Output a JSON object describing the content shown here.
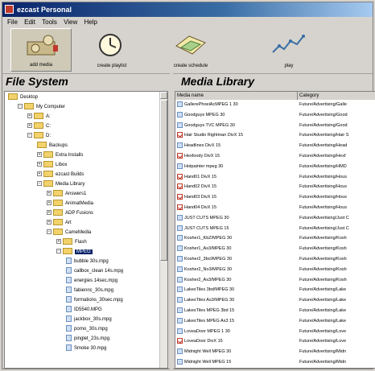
{
  "window": {
    "title": "ezcast Personal"
  },
  "menu": [
    "File",
    "Edit",
    "Tools",
    "View",
    "Help"
  ],
  "toolbar": [
    {
      "label": "add media",
      "icon": "projector-icon"
    },
    {
      "label": "create playlist",
      "icon": "clock-icon"
    },
    {
      "label": "create schedule",
      "icon": "schedule-icon"
    },
    {
      "label": "play",
      "icon": "play-icon"
    }
  ],
  "file_system": {
    "header": "File System",
    "tree": [
      {
        "label": "Desktop",
        "depth": 0,
        "type": "folder"
      },
      {
        "label": "My Computer",
        "depth": 1,
        "type": "folder",
        "expander": "−"
      },
      {
        "label": "A:",
        "depth": 2,
        "type": "drive",
        "expander": "+"
      },
      {
        "label": "C:",
        "depth": 2,
        "type": "drive",
        "expander": "+"
      },
      {
        "label": "D:",
        "depth": 2,
        "type": "drive",
        "expander": "−"
      },
      {
        "label": "Backups",
        "depth": 3,
        "type": "folder"
      },
      {
        "label": "Extra Installs",
        "depth": 3,
        "type": "folder",
        "expander": "+"
      },
      {
        "label": "Libox",
        "depth": 3,
        "type": "folder",
        "expander": "+"
      },
      {
        "label": "ezcast Builds",
        "depth": 3,
        "type": "folder",
        "expander": "+"
      },
      {
        "label": "Media Library",
        "depth": 3,
        "type": "folder",
        "expander": "−"
      },
      {
        "label": "Answers1",
        "depth": 4,
        "type": "folder",
        "expander": "+"
      },
      {
        "label": "AnimatMedia",
        "depth": 4,
        "type": "folder",
        "expander": "+"
      },
      {
        "label": "ADP Fusions",
        "depth": 4,
        "type": "folder",
        "expander": "+"
      },
      {
        "label": "Art",
        "depth": 4,
        "type": "folder",
        "expander": "+"
      },
      {
        "label": "CameMedia",
        "depth": 4,
        "type": "folder",
        "expander": "−"
      },
      {
        "label": "Flash",
        "depth": 5,
        "type": "folder",
        "expander": "+"
      },
      {
        "label": "MPEG",
        "depth": 5,
        "type": "folder",
        "expander": "−",
        "selected": true
      },
      {
        "label": "bubble 30s.mpg",
        "depth": 6,
        "type": "file"
      },
      {
        "label": "callbox_clean 14s.mpg",
        "depth": 6,
        "type": "file"
      },
      {
        "label": "energies 14sec.mpg",
        "depth": 6,
        "type": "file"
      },
      {
        "label": "fabiennc_30s.mpg",
        "depth": 6,
        "type": "file"
      },
      {
        "label": "formations_30sec.mpg",
        "depth": 6,
        "type": "file"
      },
      {
        "label": "ID5540.MPG",
        "depth": 6,
        "type": "file"
      },
      {
        "label": "jackbox_30s.mpg",
        "depth": 6,
        "type": "file"
      },
      {
        "label": "porno_30s.mpg",
        "depth": 6,
        "type": "file"
      },
      {
        "label": "pinglet_23s.mpg",
        "depth": 6,
        "type": "file"
      },
      {
        "label": "Smoke 30.mpg",
        "depth": 6,
        "type": "file"
      }
    ]
  },
  "media_library": {
    "header": "Media Library",
    "columns": [
      "Media name",
      "Category"
    ],
    "rows": [
      {
        "name": "GallerePhoeiAcMPEG 1 30",
        "category": "Future/Advertising/Galle",
        "icon": "video"
      },
      {
        "name": "Goodguys MPEG 30",
        "category": "Future/Advertising/Good",
        "icon": "video"
      },
      {
        "name": "Goodguys TVC MPEG 30",
        "category": "Future/Advertising/Good",
        "icon": "video"
      },
      {
        "name": "Hair Studio Rightman DivX 15",
        "category": "Future/Advertising/Hair S",
        "icon": "check"
      },
      {
        "name": "Headlines DivX 15",
        "category": "Future/Advertising/Head",
        "icon": "video"
      },
      {
        "name": "Hexfoody DivX 15",
        "category": "Future/Advertising/Hexf",
        "icon": "check"
      },
      {
        "name": "Hotpainter mpeg 30",
        "category": "Future/Advertising/HMD",
        "icon": "video"
      },
      {
        "name": "Hand01 DivX 15",
        "category": "Future/Advertising/Hous",
        "icon": "check"
      },
      {
        "name": "Hand02 DivX 15",
        "category": "Future/Advertising/Hous",
        "icon": "check"
      },
      {
        "name": "Hand03 DivX 15",
        "category": "Future/Advertising/Hous",
        "icon": "check"
      },
      {
        "name": "Hand04 DivX 15",
        "category": "Future/Advertising/Hous",
        "icon": "check"
      },
      {
        "name": "JUST CUTS MPEG 30",
        "category": "Future/Advertising/Just C",
        "icon": "video"
      },
      {
        "name": "JUST CUTS MPEG 15",
        "category": "Future/Advertising/Just C",
        "icon": "video"
      },
      {
        "name": "Kosher1_KbZ/MPEG 30",
        "category": "Future/Advertising/Kosh",
        "icon": "video"
      },
      {
        "name": "Kosher1_As3/MPEG 30",
        "category": "Future/Advertising/Kosh",
        "icon": "video"
      },
      {
        "name": "Kosher2_3bcl/MPEG 30",
        "category": "Future/Advertising/Kosh",
        "icon": "video"
      },
      {
        "name": "Kosher2_No3/MPEG 30",
        "category": "Future/Advertising/Kosh",
        "icon": "video"
      },
      {
        "name": "Kosher2_As3/MPEG 30",
        "category": "Future/Advertising/Kosh",
        "icon": "video"
      },
      {
        "name": "LakesTiles 3bd/MPEG 30",
        "category": "Future/Advertising/Lake",
        "icon": "video"
      },
      {
        "name": "LakesTiles As3/MPEG 30",
        "category": "Future/Advertising/Lake",
        "icon": "video"
      },
      {
        "name": "LakesTiles MPEG 3bd 15",
        "category": "Future/Advertising/Lake",
        "icon": "video"
      },
      {
        "name": "LakesTiles MPEG As3 15",
        "category": "Future/Advertising/Lake",
        "icon": "video"
      },
      {
        "name": "LoveaDoor MPEG 1 30",
        "category": "Future/Advertising/Love",
        "icon": "video"
      },
      {
        "name": "LoveaDoor DivX 15",
        "category": "Future/Advertising/Love",
        "icon": "check"
      },
      {
        "name": "Midnight Well MPEG 30",
        "category": "Future/Advertising/Midn",
        "icon": "video"
      },
      {
        "name": "Midnight Well MPEG 15",
        "category": "Future/Advertising/Midn",
        "icon": "video"
      }
    ]
  },
  "colors": {
    "titlebar": "#0a246a",
    "selection": "#0a246a",
    "check": "#c0392b",
    "folder": "#f2d26b"
  }
}
